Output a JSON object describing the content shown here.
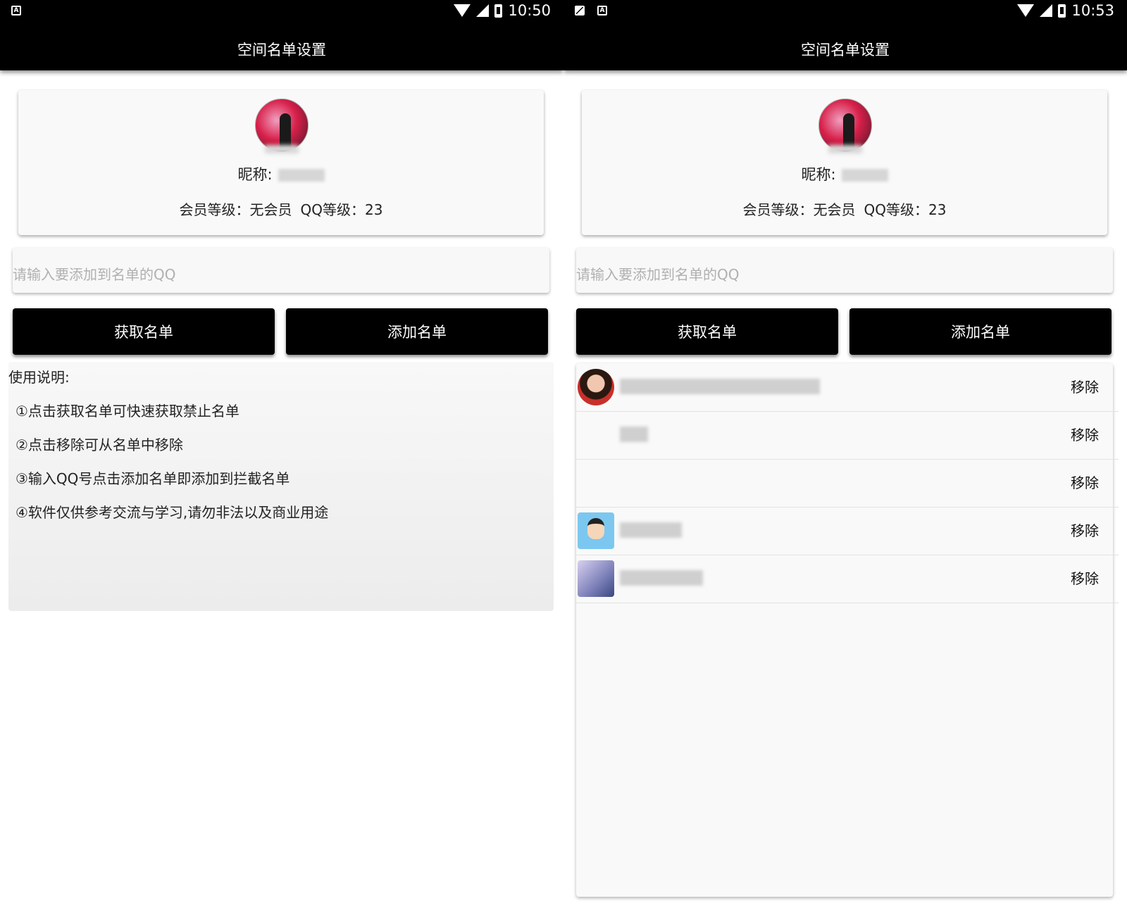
{
  "screens": [
    {
      "status": {
        "time": "10:50"
      },
      "toolbar": {
        "title": "空间名单设置"
      },
      "profile": {
        "nick_label": "昵称:",
        "level_text": "会员等级：无会员",
        "qq_level_text": "QQ等级：23"
      },
      "input": {
        "placeholder": "请输入要添加到名单的QQ"
      },
      "buttons": {
        "fetch": "获取名单",
        "add": "添加名单"
      },
      "help": {
        "title": "使用说明:",
        "items": [
          "①点击获取名单可快速获取禁止名单",
          "②点击移除可从名单中移除",
          "③输入QQ号点击添加名单即添加到拦截名单",
          "④软件仅供参考交流与学习,请勿非法以及商业用途"
        ]
      }
    },
    {
      "status": {
        "time": "10:53"
      },
      "toolbar": {
        "title": "空间名单设置"
      },
      "profile": {
        "nick_label": "昵称:",
        "level_text": "会员等级：无会员",
        "qq_level_text": "QQ等级：23"
      },
      "input": {
        "placeholder": "请输入要添加到名单的QQ"
      },
      "buttons": {
        "fetch": "获取名单",
        "add": "添加名单"
      },
      "list": {
        "remove_label": "移除",
        "rows": [
          {
            "avatar": "avatar-anime-red"
          },
          {
            "avatar": ""
          },
          {
            "avatar": ""
          },
          {
            "avatar": "avatar-cartoon-boy"
          },
          {
            "avatar": "avatar-purple-art"
          }
        ]
      }
    }
  ]
}
